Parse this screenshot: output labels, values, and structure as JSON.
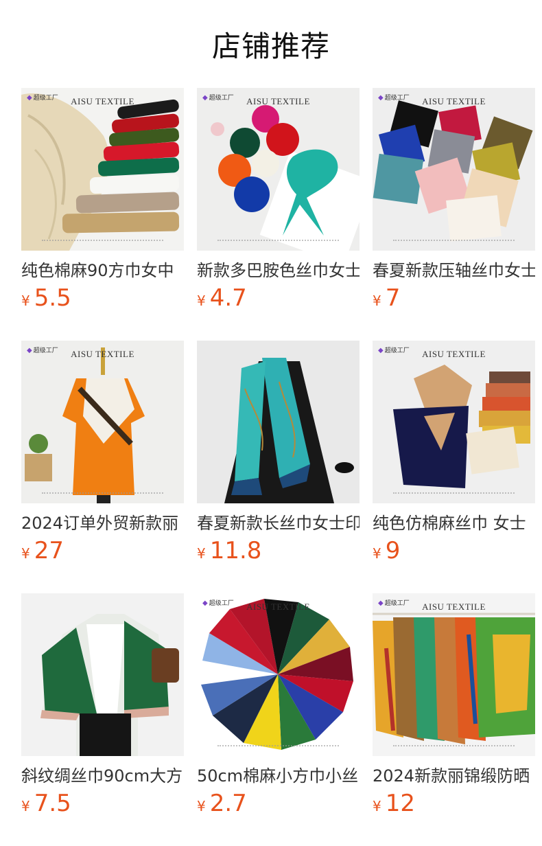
{
  "section_title": "店铺推荐",
  "products": [
    {
      "name": "纯色棉麻90方巾女中",
      "currency": "¥",
      "price": "5.5",
      "brand": "AISU TEXTILE",
      "badge": "超级工厂"
    },
    {
      "name": "新款多巴胺色丝巾女士",
      "currency": "¥",
      "price": "4.7",
      "brand": "AISU TEXTILE",
      "badge": "超级工厂"
    },
    {
      "name": "春夏新款压轴丝巾女士",
      "currency": "¥",
      "price": "7",
      "brand": "AISU TEXTILE",
      "badge": "超级工厂"
    },
    {
      "name": "2024订单外贸新款丽",
      "currency": "¥",
      "price": "27",
      "brand": "AISU TEXTILE",
      "badge": "超级工厂"
    },
    {
      "name": "春夏新款长丝巾女士印",
      "currency": "¥",
      "price": "11.8",
      "brand": "",
      "badge": ""
    },
    {
      "name": "纯色仿棉麻丝巾 女士",
      "currency": "¥",
      "price": "9",
      "brand": "AISU TEXTILE",
      "badge": "超级工厂"
    },
    {
      "name": "斜纹绸丝巾90cm大方",
      "currency": "¥",
      "price": "7.5",
      "brand": "",
      "badge": ""
    },
    {
      "name": "50cm棉麻小方巾小丝",
      "currency": "¥",
      "price": "2.7",
      "brand": "AISU TEXTILE",
      "badge": "超级工厂"
    },
    {
      "name": "2024新款丽锦缎防晒",
      "currency": "¥",
      "price": "12",
      "brand": "AISU TEXTILE",
      "badge": "超级工厂"
    }
  ]
}
